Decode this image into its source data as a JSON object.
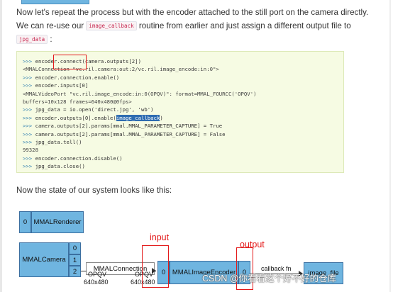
{
  "intro": {
    "p1": "Now let's repeat the process but with the encoder attached to the still port on the camera directly.",
    "p2a": "We can re-use our",
    "code1": "image_callback",
    "p2b": "routine from earlier and just assign a different output file to",
    "code2": "jpg_data",
    "p2c": ":"
  },
  "code_lines": [
    {
      "p": ">>> ",
      "t": "encoder",
      "hl_red": ".connect(",
      "rest": "camera.outputs[2])",
      "kind": "in"
    },
    {
      "p": "",
      "t": "<MMALConnection \"vc.ril.camera:out:2/vc.ril.image_encode:in:0\">",
      "kind": "out"
    },
    {
      "p": ">>> ",
      "t": "encoder.connection.enable()",
      "kind": "in"
    },
    {
      "p": ">>> ",
      "t": "encoder.inputs[0]",
      "kind": "in"
    },
    {
      "p": "",
      "t": "<MMALVideoPort \"vc.ril.image_encode:in:0(OPQV)\": format=MMAL_FOURCC('OPQV')",
      "kind": "out"
    },
    {
      "p": "",
      "t": "buffers=10x128 frames=640x480@0fps>",
      "kind": "out"
    },
    {
      "p": ">>> ",
      "t": "jpg_data = io.open('direct.jpg', 'wb')",
      "kind": "in"
    },
    {
      "p": ">>> ",
      "t": "encoder.outputs[0].enable(",
      "hl": "image_callback",
      "rest": ")",
      "kind": "in"
    },
    {
      "p": ">>> ",
      "t": "camera.outputs[2].params[mmal.MMAL_PARAMETER_CAPTURE] = True",
      "kind": "in"
    },
    {
      "p": ">>> ",
      "t": "camera.outputs[2].params[mmal.MMAL_PARAMETER_CAPTURE] = False",
      "kind": "in"
    },
    {
      "p": ">>> ",
      "t": "jpg_data.tell()",
      "kind": "in"
    },
    {
      "p": "",
      "t": "99328",
      "kind": "out"
    },
    {
      "p": ">>> ",
      "t": "encoder.connection.disable()",
      "kind": "in"
    },
    {
      "p": ">>> ",
      "t": "jpg_data.close()",
      "kind": "in"
    }
  ],
  "state_text": "Now the state of our system looks like this:",
  "diagram": {
    "renderer_port": "0",
    "renderer_label": "MMALRenderer",
    "camera_label": "MMALCamera",
    "camera_ports": [
      "0",
      "1",
      "2"
    ],
    "connection_label": "MMALConnection",
    "left_format": "OPQV",
    "left_size": "640x480",
    "right_format": "OPQV",
    "right_size": "640x480",
    "encoder_in_port": "0",
    "encoder_label": "MMALImageEncoder",
    "encoder_out_port": "0",
    "callback_label": "callback fn",
    "file_label": "image_file",
    "input_annotation": "input",
    "output_annotation": "output",
    "watermark": "CSDN @你看看这个好不好的仓库"
  },
  "colors": {
    "block": "#6fb5e0",
    "annotation": "#e31a1a",
    "code_bg": "#f6fbe3",
    "prompt": "#2f7fb0"
  }
}
